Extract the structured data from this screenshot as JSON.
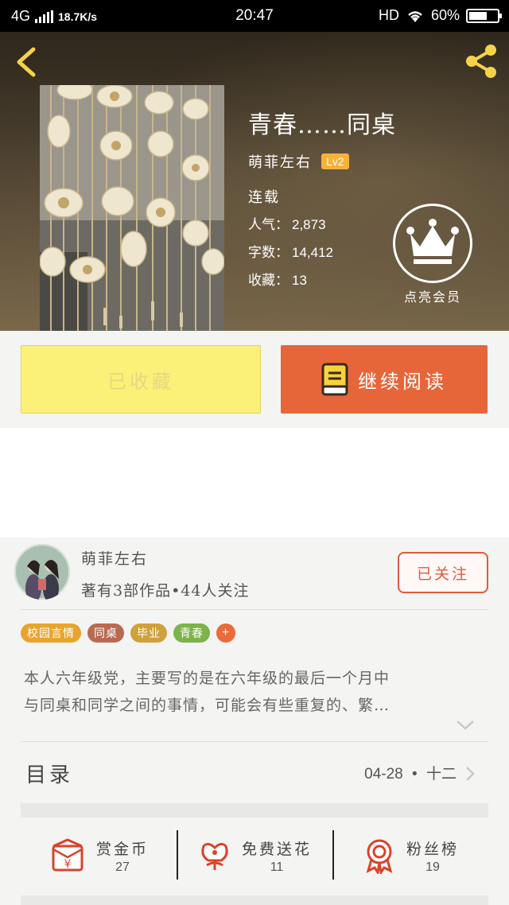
{
  "status_bar": {
    "network": "4G",
    "speed": "18.7K/s",
    "time": "20:47",
    "hd": "HD",
    "battery": "60%"
  },
  "icons": {
    "back": "back-arrow-icon",
    "share": "share-icon",
    "crown": "crown-icon",
    "book": "book-icon",
    "red_envelope": "red-envelope-icon",
    "flower": "flower-icon",
    "badge": "ribbon-badge-icon"
  },
  "book": {
    "title": "青春……同桌",
    "author": "萌菲左右",
    "level": "Lv2",
    "status": "连载",
    "popularity_label": "人气：",
    "popularity": "2,873",
    "words_label": "字数：",
    "words": "14,412",
    "favorites_label": "收藏：",
    "favorites": "13"
  },
  "vip": {
    "label": "点亮会员"
  },
  "actions": {
    "favorited": "已收藏",
    "continue_reading": "继续阅读"
  },
  "author_card": {
    "name": "萌菲左右",
    "works": "著有3部作品•44人关注",
    "follow": "已关注"
  },
  "tags": [
    {
      "label": "校园言情",
      "color": "#e8a52e"
    },
    {
      "label": "同桌",
      "color": "#b96a52"
    },
    {
      "label": "毕业",
      "color": "#d0a13a"
    },
    {
      "label": "青春",
      "color": "#7eb24a"
    },
    {
      "label": "+",
      "color": "#ec6a3a"
    }
  ],
  "description": {
    "line1": "本人六年级党，主要写的是在六年级的最后一个月中",
    "line2": "与同桌和同学之间的事情，可能会有些重复的、繁…"
  },
  "toc": {
    "title": "目录",
    "latest_date": "04-28",
    "separator": "•",
    "latest_chapter": "十二"
  },
  "rewards": [
    {
      "label": "赏金币",
      "count": "27"
    },
    {
      "label": "免费送花",
      "count": "11"
    },
    {
      "label": "粉丝榜",
      "count": "19"
    }
  ],
  "colors": {
    "accent_orange": "#e6663a",
    "favorite_yellow": "#fbf178",
    "follow_red": "#e05a3a",
    "level_badge": "#f5b23a",
    "reward_red": "#d9432a"
  }
}
